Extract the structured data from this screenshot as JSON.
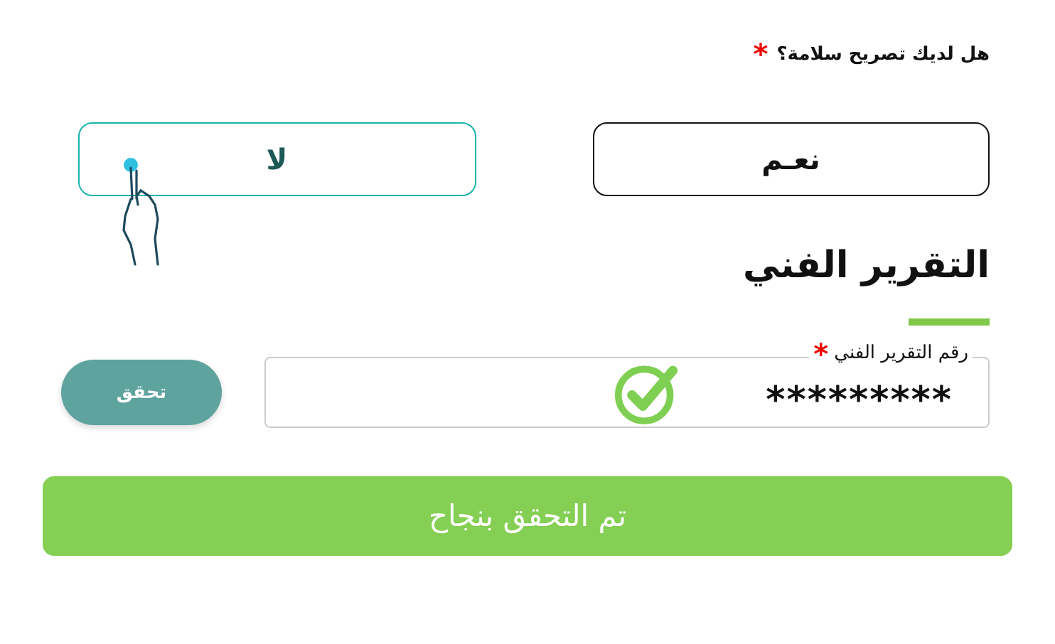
{
  "question": {
    "text": "هل لديك تصريح سلامة؟",
    "required_mark": "*"
  },
  "options": [
    {
      "label": "نعـم",
      "selected": false
    },
    {
      "label": "لا",
      "selected": true
    }
  ],
  "section_title": "التقرير الفني",
  "report_field": {
    "label": "رقم التقرير الفني",
    "required_mark": "*",
    "value": "*********",
    "verified": true
  },
  "verify_button": "تحقق",
  "success_banner": "تم التحقق بنجاح"
}
